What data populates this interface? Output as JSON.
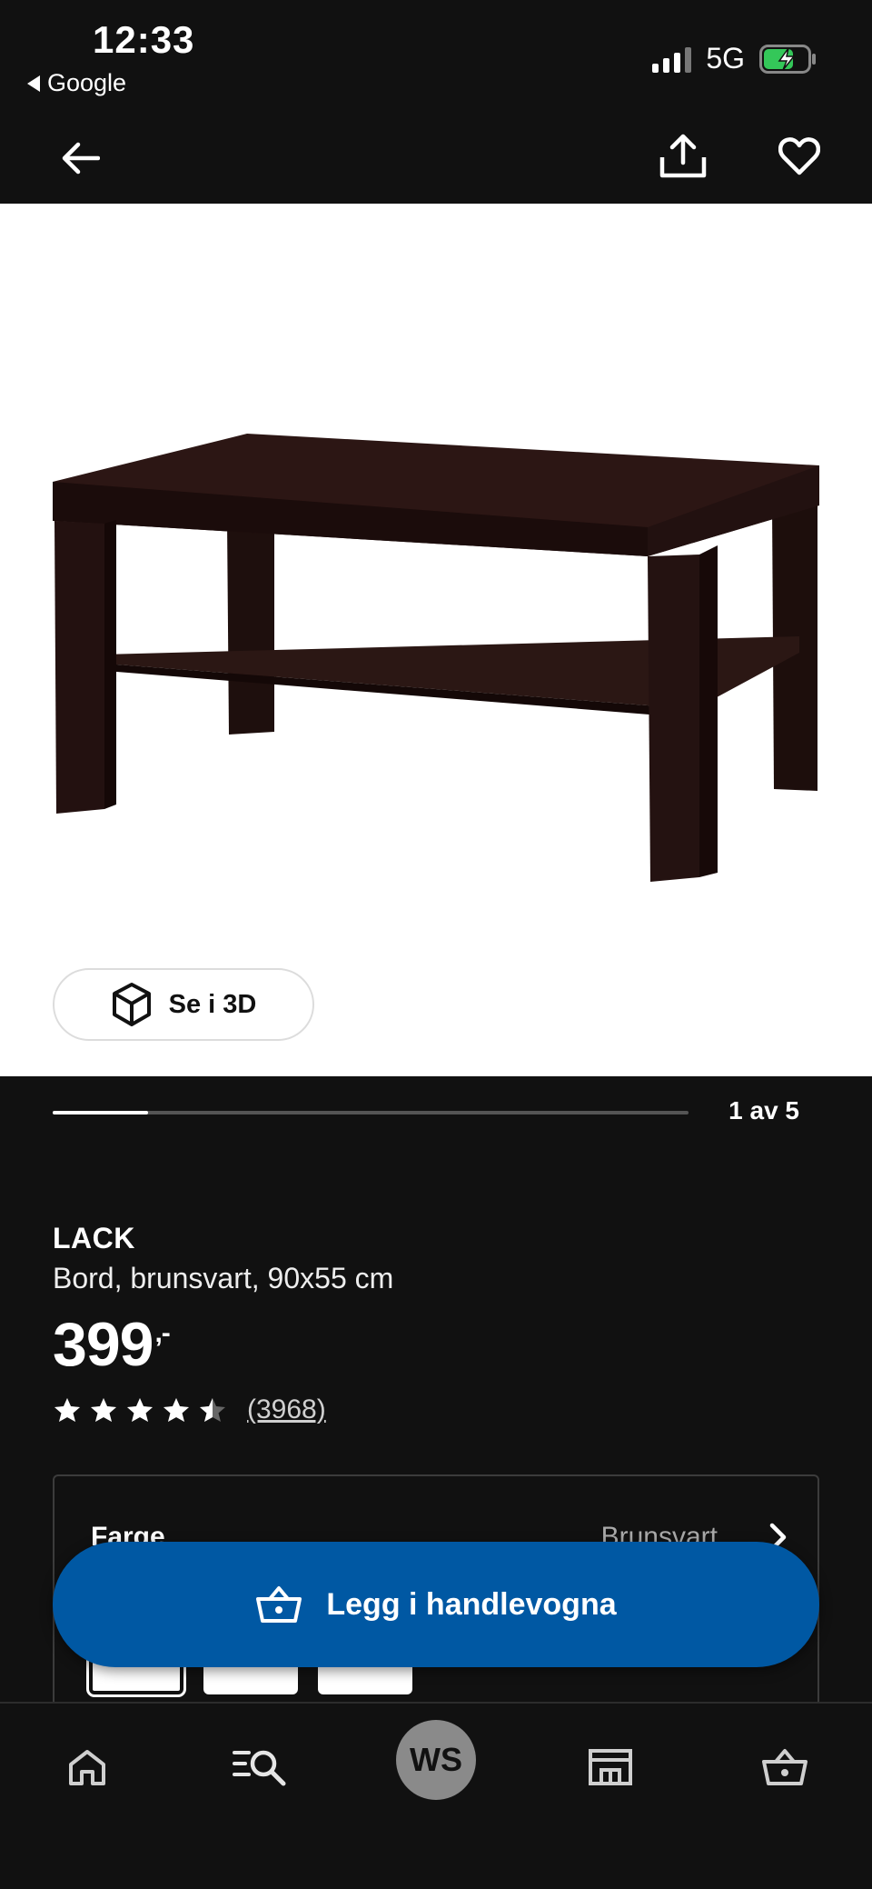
{
  "status_bar": {
    "time": "12:33",
    "back_app": "Google",
    "network": "5G",
    "signal_icon": "cellular-signal-icon",
    "battery_icon": "battery-charging-icon"
  },
  "top_nav": {
    "back_icon": "arrow-left-icon",
    "share_icon": "share-icon",
    "favorite_icon": "heart-icon"
  },
  "gallery": {
    "view_3d_label": "Se i 3D",
    "view_3d_icon": "cube-icon",
    "position_label": "1 av 5",
    "progress": 0.15
  },
  "product": {
    "name": "LACK",
    "description": "Bord, brunsvart, 90x55 cm",
    "price": "399",
    "price_suffix": ",-",
    "rating": 4.5,
    "review_count": "(3968)"
  },
  "variant": {
    "label": "Farge",
    "value": "Brunsvart",
    "chevron_icon": "chevron-right-icon",
    "swatch_count": 3
  },
  "cart_button": {
    "label": "Legg i handlevogna",
    "icon": "basket-icon",
    "color": "#0058a3"
  },
  "tab_bar": {
    "items": [
      {
        "name": "home",
        "icon": "home-icon"
      },
      {
        "name": "search",
        "icon": "search-list-icon"
      },
      {
        "name": "profile",
        "initials": "WS"
      },
      {
        "name": "store",
        "icon": "store-icon"
      },
      {
        "name": "cart",
        "icon": "basket-icon"
      }
    ]
  },
  "colors": {
    "background": "#111111",
    "accent": "#0058a3",
    "table": "#2a1512"
  }
}
